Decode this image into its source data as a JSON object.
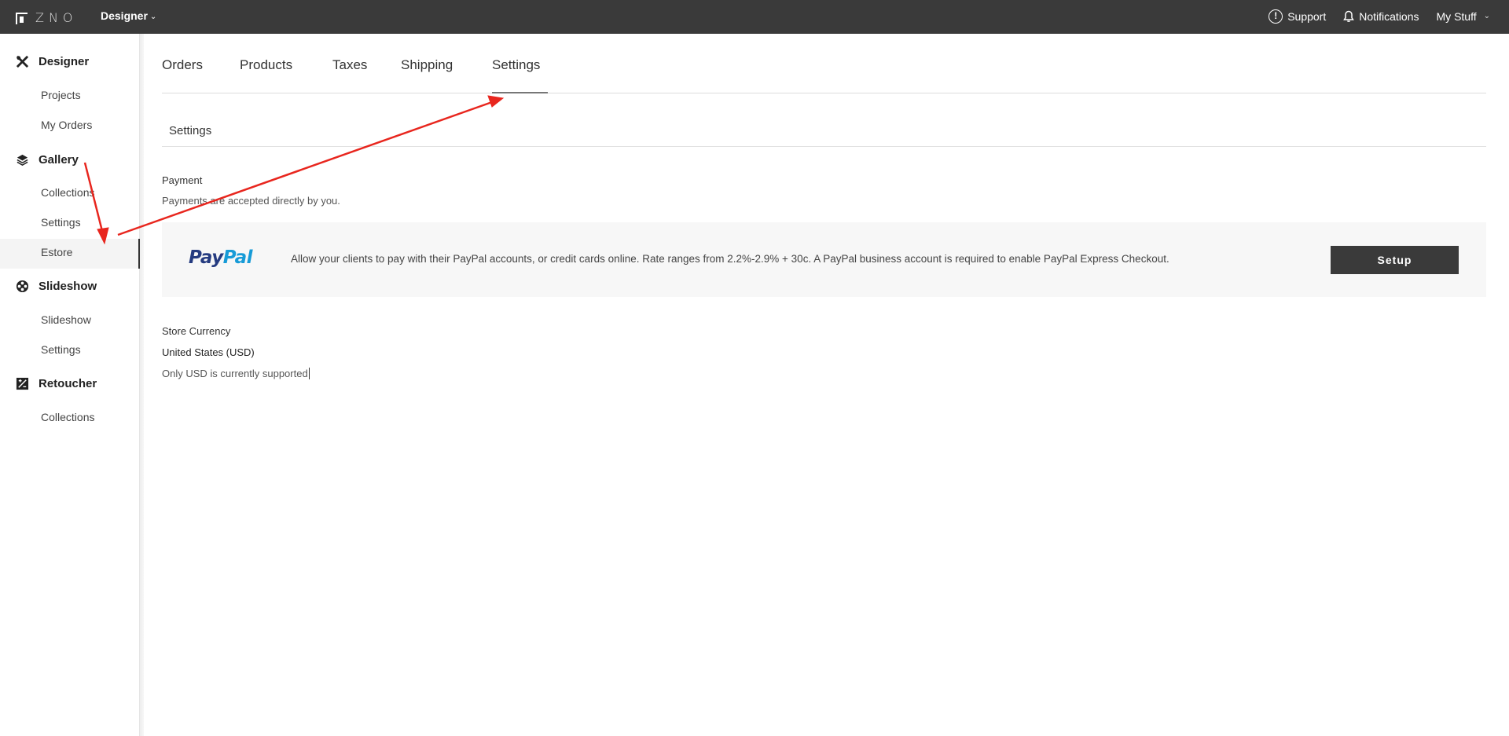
{
  "topbar": {
    "logo_text": "ZNO",
    "app_switcher": "Designer",
    "support": "Support",
    "notifications": "Notifications",
    "my_stuff": "My Stuff"
  },
  "sidebar": {
    "sections": [
      {
        "label": "Designer",
        "icon": "designer-tools-icon",
        "items": [
          "Projects",
          "My Orders"
        ]
      },
      {
        "label": "Gallery",
        "icon": "layers-icon",
        "items": [
          "Collections",
          "Settings",
          "Estore"
        ]
      },
      {
        "label": "Slideshow",
        "icon": "film-reel-icon",
        "items": [
          "Slideshow",
          "Settings"
        ]
      },
      {
        "label": "Retoucher",
        "icon": "retoucher-icon",
        "items": [
          "Collections"
        ]
      }
    ],
    "active_item": "Estore"
  },
  "tabs": [
    "Orders",
    "Products",
    "Taxes",
    "Shipping",
    "Settings"
  ],
  "active_tab": "Settings",
  "content": {
    "section_title": "Settings",
    "payment_label": "Payment",
    "payment_desc": "Payments are accepted directly by you.",
    "paypal_logo_a": "Pay",
    "paypal_logo_b": "Pal",
    "paypal_text": "Allow your clients to pay with their PayPal accounts, or credit cards online. Rate ranges from 2.2%-2.9% + 30c. A PayPal business account is required to enable PayPal Express Checkout.",
    "setup_button": "Setup",
    "currency_label": "Store Currency",
    "currency_value": "United States (USD)",
    "currency_note": "Only USD is currently supported"
  },
  "colors": {
    "topbar": "#3a3a3a",
    "paypal_dark": "#253b80",
    "paypal_light": "#179bd7",
    "annotation_arrow": "#e8261e"
  }
}
